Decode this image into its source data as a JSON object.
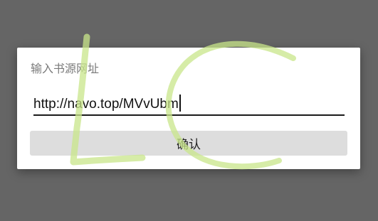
{
  "dialog": {
    "title": "输入书源网址",
    "url_value": "http://navo.top/MVvUbm",
    "confirm_label": "确认"
  },
  "watermark": {
    "color": "#c8e68a"
  },
  "colors": {
    "backdrop": "#656565",
    "dialog_bg": "#ffffff",
    "button_bg": "#dddddd",
    "underline": "#1a1a1a"
  }
}
